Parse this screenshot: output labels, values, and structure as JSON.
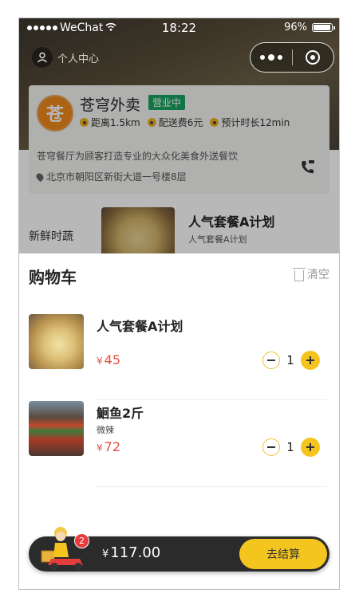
{
  "status_bar": {
    "carrier": "WeChat",
    "time": "18:22",
    "battery": "96%"
  },
  "nav": {
    "personal_center": "个人中心"
  },
  "shop": {
    "logo_text": "苍",
    "name": "苍穹外卖",
    "status": "营业中",
    "distance": "距离1.5km",
    "delivery_fee": "配送费6元",
    "eta": "预计时长12min",
    "description": "苍穹餐厅为顾客打造专业的大众化美食外送餐饮",
    "address": "北京市朝阳区新街大道一号楼8层"
  },
  "menu": {
    "category": "新鲜时蔬",
    "item_name": "人气套餐A计划",
    "item_sub": "人气套餐A计划"
  },
  "cart": {
    "title": "购物车",
    "clear_label": "清空",
    "currency": "¥",
    "items": [
      {
        "name": "人气套餐A计划",
        "sub": "",
        "price": "45",
        "qty": "1"
      },
      {
        "name": "鮰鱼2斤",
        "sub": "微辣",
        "price": "72",
        "qty": "1"
      }
    ],
    "total": "117.00",
    "count_badge": "2",
    "checkout_label": "去结算"
  },
  "colors": {
    "accent": "#f5c51f",
    "price": "#e3533f",
    "open_badge": "#1aa361"
  }
}
